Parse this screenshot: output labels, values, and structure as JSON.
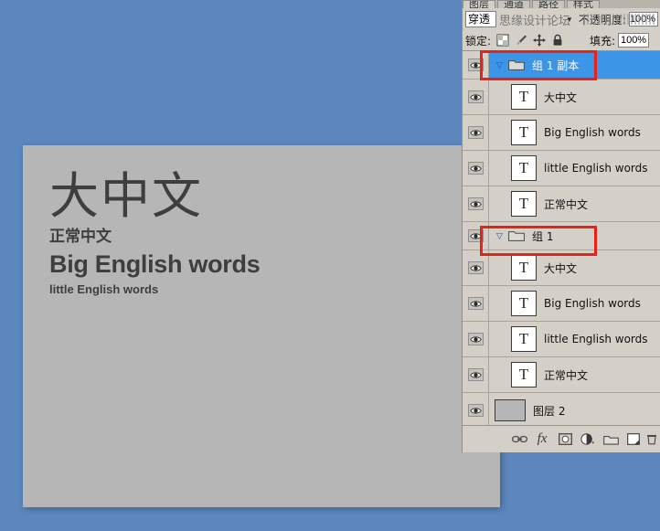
{
  "app": {
    "name": "Photoshop Layers Panel"
  },
  "canvas": {
    "lines": {
      "big_cn": "大中文",
      "normal_cn": "正常中文",
      "big_en": "Big English words",
      "small_en": "little English words"
    }
  },
  "panel": {
    "tabs": [
      {
        "label": "图层",
        "active": true
      },
      {
        "label": "通道",
        "active": false
      },
      {
        "label": "路径",
        "active": false
      },
      {
        "label": "样式",
        "active": false
      }
    ],
    "blend": {
      "value": "穿透",
      "chevron": "chevron-down-icon",
      "watermark": "思缘设计论坛"
    },
    "opacity": {
      "label": "不透明度:",
      "value": "100%"
    },
    "lock": {
      "label": "锁定:",
      "icons": [
        "transparency-lock-icon",
        "brush-lock-icon",
        "move-lock-icon",
        "all-lock-icon"
      ]
    },
    "fill": {
      "label": "填充:",
      "value": "100%"
    },
    "footer_icons": [
      "link-layers-icon",
      "layer-style-fx-icon",
      "add-mask-icon",
      "adjustment-layer-icon",
      "new-group-icon",
      "new-layer-icon",
      "delete-layer-icon"
    ],
    "footer_fx_label": "fx"
  },
  "layers": [
    {
      "name": "组 1 副本",
      "type": "group",
      "indent": 0,
      "selected": true,
      "visible": true,
      "expanded": true,
      "highlight": true
    },
    {
      "name": "大中文",
      "type": "text",
      "indent": 1,
      "selected": false,
      "visible": true,
      "thumb": "T",
      "highlight": false
    },
    {
      "name": "Big English words",
      "type": "text",
      "indent": 1,
      "selected": false,
      "visible": true,
      "thumb": "T",
      "highlight": false
    },
    {
      "name": "little English words",
      "type": "text",
      "indent": 1,
      "selected": false,
      "visible": true,
      "thumb": "T",
      "highlight": false
    },
    {
      "name": "正常中文",
      "type": "text",
      "indent": 1,
      "selected": false,
      "visible": true,
      "thumb": "T",
      "highlight": false
    },
    {
      "name": "组 1",
      "type": "group",
      "indent": 0,
      "selected": false,
      "visible": true,
      "expanded": true,
      "highlight": true
    },
    {
      "name": "大中文",
      "type": "text",
      "indent": 1,
      "selected": false,
      "visible": true,
      "thumb": "T",
      "highlight": false
    },
    {
      "name": "Big English words",
      "type": "text",
      "indent": 1,
      "selected": false,
      "visible": true,
      "thumb": "T",
      "highlight": false
    },
    {
      "name": "little English words",
      "type": "text",
      "indent": 1,
      "selected": false,
      "visible": true,
      "thumb": "T",
      "highlight": false
    },
    {
      "name": "正常中文",
      "type": "text",
      "indent": 1,
      "selected": false,
      "visible": true,
      "thumb": "T",
      "highlight": false
    },
    {
      "name": "图层 2",
      "type": "solid",
      "indent": 0,
      "selected": false,
      "visible": true,
      "highlight": false
    }
  ],
  "colors": {
    "desktop_blue": "#5b87bd",
    "canvas_gray": "#b6b6b6",
    "panel_gray": "#d4d0c8",
    "selection_blue": "#3d95e8",
    "annotation_red": "#e8211b",
    "group_name_blue": "#1c4fa0"
  }
}
